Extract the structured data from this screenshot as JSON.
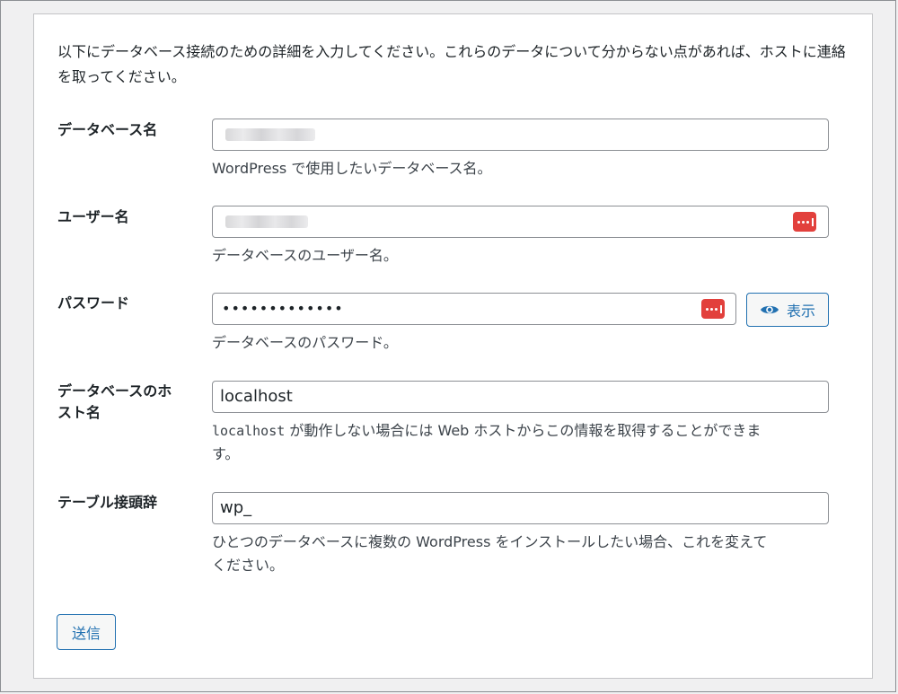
{
  "intro_text": "以下にデータベース接続のための詳細を入力してください。これらのデータについて分からない点があれば、ホストに連絡を取ってください。",
  "fields": {
    "dbname": {
      "label": "データベース名",
      "value": "",
      "description": "WordPress で使用したいデータベース名。"
    },
    "uname": {
      "label": "ユーザー名",
      "value": "",
      "description": "データベースのユーザー名。"
    },
    "pwd": {
      "label": "パスワード",
      "value": "•••••••••••••",
      "description": "データベースのパスワード。",
      "show_button_label": "表示"
    },
    "dbhost": {
      "label_line1": "データベースのホ",
      "label_line2": "スト名",
      "value": "localhost",
      "description_code": "localhost",
      "description_rest": " が動作しない場合には Web ホストからこの情報を取得することができま",
      "description_line2": "す。"
    },
    "prefix": {
      "label": "テーブル接頭辞",
      "value": "wp_",
      "description_line1": "ひとつのデータベースに複数の WordPress をインストールしたい場合、これを変えて",
      "description_line2": "ください。"
    }
  },
  "submit_label": "送信",
  "icons": {
    "password_manager": "password-manager-icon",
    "show_password": "eye-icon"
  },
  "colors": {
    "accent": "#2271b1",
    "password_manager": "#e2403c"
  }
}
